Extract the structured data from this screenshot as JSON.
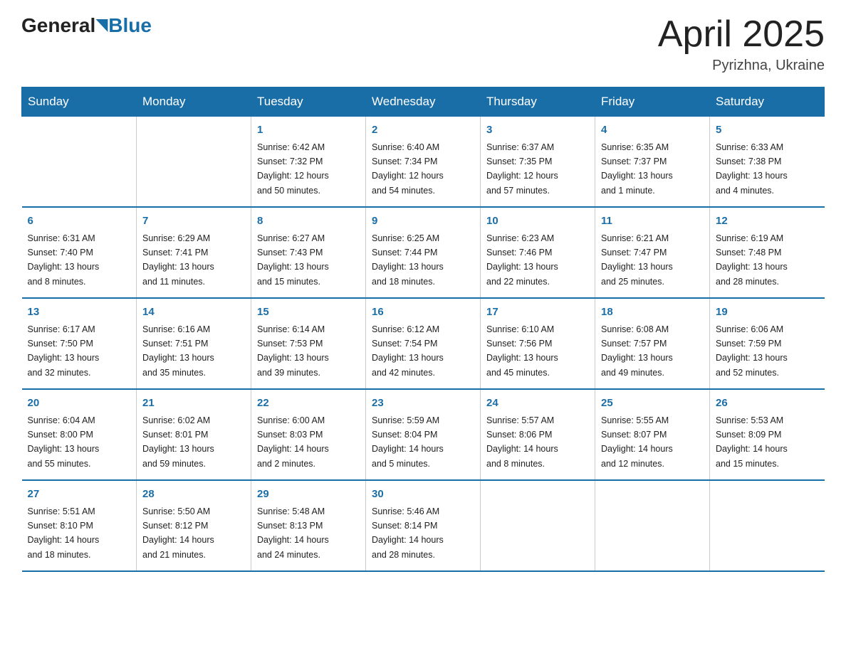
{
  "header": {
    "logo_general": "General",
    "logo_blue": "Blue",
    "month_title": "April 2025",
    "location": "Pyrizhna, Ukraine"
  },
  "days_of_week": [
    "Sunday",
    "Monday",
    "Tuesday",
    "Wednesday",
    "Thursday",
    "Friday",
    "Saturday"
  ],
  "weeks": [
    [
      {
        "day": "",
        "info": ""
      },
      {
        "day": "",
        "info": ""
      },
      {
        "day": "1",
        "info": "Sunrise: 6:42 AM\nSunset: 7:32 PM\nDaylight: 12 hours\nand 50 minutes."
      },
      {
        "day": "2",
        "info": "Sunrise: 6:40 AM\nSunset: 7:34 PM\nDaylight: 12 hours\nand 54 minutes."
      },
      {
        "day": "3",
        "info": "Sunrise: 6:37 AM\nSunset: 7:35 PM\nDaylight: 12 hours\nand 57 minutes."
      },
      {
        "day": "4",
        "info": "Sunrise: 6:35 AM\nSunset: 7:37 PM\nDaylight: 13 hours\nand 1 minute."
      },
      {
        "day": "5",
        "info": "Sunrise: 6:33 AM\nSunset: 7:38 PM\nDaylight: 13 hours\nand 4 minutes."
      }
    ],
    [
      {
        "day": "6",
        "info": "Sunrise: 6:31 AM\nSunset: 7:40 PM\nDaylight: 13 hours\nand 8 minutes."
      },
      {
        "day": "7",
        "info": "Sunrise: 6:29 AM\nSunset: 7:41 PM\nDaylight: 13 hours\nand 11 minutes."
      },
      {
        "day": "8",
        "info": "Sunrise: 6:27 AM\nSunset: 7:43 PM\nDaylight: 13 hours\nand 15 minutes."
      },
      {
        "day": "9",
        "info": "Sunrise: 6:25 AM\nSunset: 7:44 PM\nDaylight: 13 hours\nand 18 minutes."
      },
      {
        "day": "10",
        "info": "Sunrise: 6:23 AM\nSunset: 7:46 PM\nDaylight: 13 hours\nand 22 minutes."
      },
      {
        "day": "11",
        "info": "Sunrise: 6:21 AM\nSunset: 7:47 PM\nDaylight: 13 hours\nand 25 minutes."
      },
      {
        "day": "12",
        "info": "Sunrise: 6:19 AM\nSunset: 7:48 PM\nDaylight: 13 hours\nand 28 minutes."
      }
    ],
    [
      {
        "day": "13",
        "info": "Sunrise: 6:17 AM\nSunset: 7:50 PM\nDaylight: 13 hours\nand 32 minutes."
      },
      {
        "day": "14",
        "info": "Sunrise: 6:16 AM\nSunset: 7:51 PM\nDaylight: 13 hours\nand 35 minutes."
      },
      {
        "day": "15",
        "info": "Sunrise: 6:14 AM\nSunset: 7:53 PM\nDaylight: 13 hours\nand 39 minutes."
      },
      {
        "day": "16",
        "info": "Sunrise: 6:12 AM\nSunset: 7:54 PM\nDaylight: 13 hours\nand 42 minutes."
      },
      {
        "day": "17",
        "info": "Sunrise: 6:10 AM\nSunset: 7:56 PM\nDaylight: 13 hours\nand 45 minutes."
      },
      {
        "day": "18",
        "info": "Sunrise: 6:08 AM\nSunset: 7:57 PM\nDaylight: 13 hours\nand 49 minutes."
      },
      {
        "day": "19",
        "info": "Sunrise: 6:06 AM\nSunset: 7:59 PM\nDaylight: 13 hours\nand 52 minutes."
      }
    ],
    [
      {
        "day": "20",
        "info": "Sunrise: 6:04 AM\nSunset: 8:00 PM\nDaylight: 13 hours\nand 55 minutes."
      },
      {
        "day": "21",
        "info": "Sunrise: 6:02 AM\nSunset: 8:01 PM\nDaylight: 13 hours\nand 59 minutes."
      },
      {
        "day": "22",
        "info": "Sunrise: 6:00 AM\nSunset: 8:03 PM\nDaylight: 14 hours\nand 2 minutes."
      },
      {
        "day": "23",
        "info": "Sunrise: 5:59 AM\nSunset: 8:04 PM\nDaylight: 14 hours\nand 5 minutes."
      },
      {
        "day": "24",
        "info": "Sunrise: 5:57 AM\nSunset: 8:06 PM\nDaylight: 14 hours\nand 8 minutes."
      },
      {
        "day": "25",
        "info": "Sunrise: 5:55 AM\nSunset: 8:07 PM\nDaylight: 14 hours\nand 12 minutes."
      },
      {
        "day": "26",
        "info": "Sunrise: 5:53 AM\nSunset: 8:09 PM\nDaylight: 14 hours\nand 15 minutes."
      }
    ],
    [
      {
        "day": "27",
        "info": "Sunrise: 5:51 AM\nSunset: 8:10 PM\nDaylight: 14 hours\nand 18 minutes."
      },
      {
        "day": "28",
        "info": "Sunrise: 5:50 AM\nSunset: 8:12 PM\nDaylight: 14 hours\nand 21 minutes."
      },
      {
        "day": "29",
        "info": "Sunrise: 5:48 AM\nSunset: 8:13 PM\nDaylight: 14 hours\nand 24 minutes."
      },
      {
        "day": "30",
        "info": "Sunrise: 5:46 AM\nSunset: 8:14 PM\nDaylight: 14 hours\nand 28 minutes."
      },
      {
        "day": "",
        "info": ""
      },
      {
        "day": "",
        "info": ""
      },
      {
        "day": "",
        "info": ""
      }
    ]
  ]
}
